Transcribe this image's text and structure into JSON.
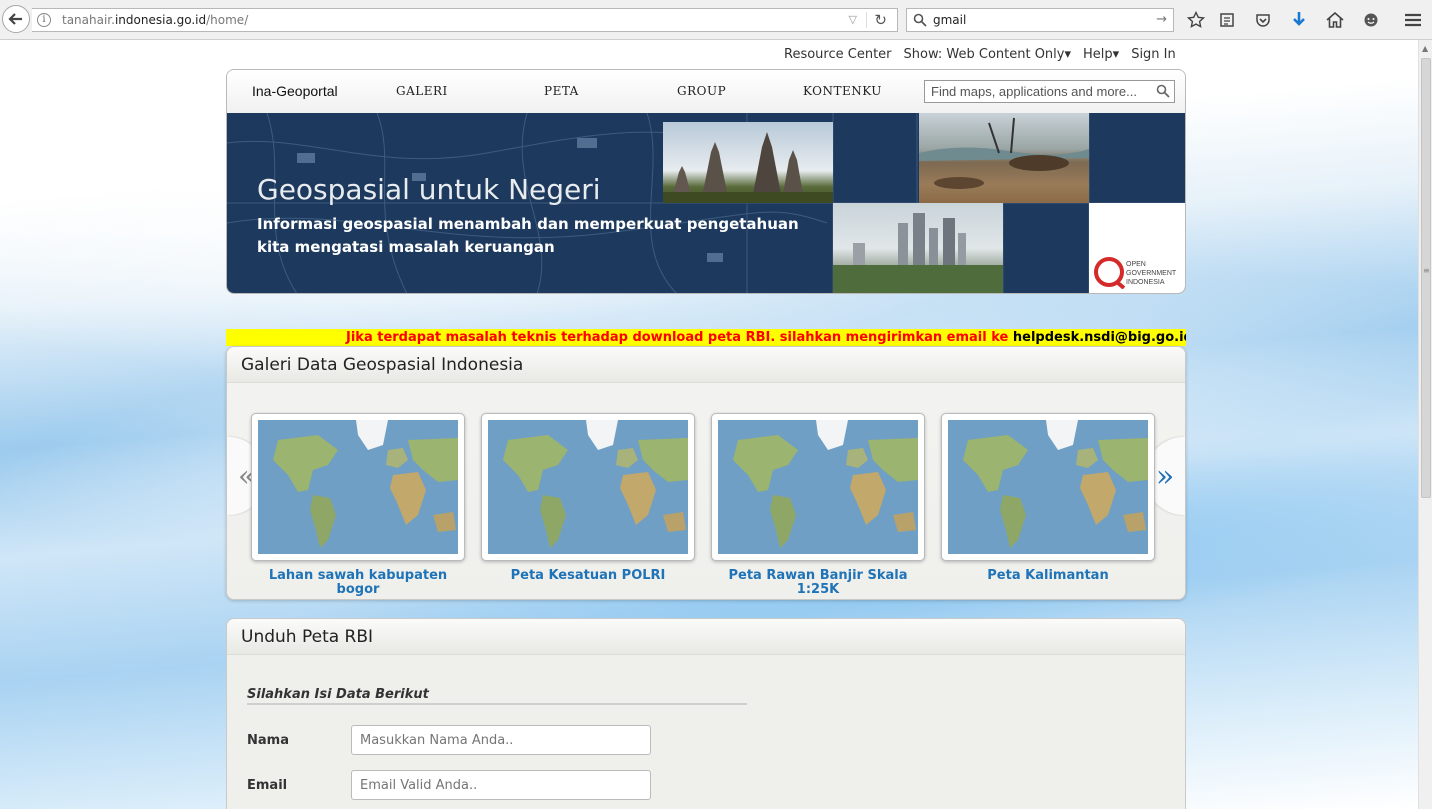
{
  "browser": {
    "url_prefix": "tanahair.",
    "url_host": "indonesia.go.id",
    "url_path": "/home/",
    "search_value": "gmail"
  },
  "top_links": [
    "Resource Center",
    "Show: Web Content Only▾",
    "Help▾",
    "Sign In"
  ],
  "nav": {
    "brand": "Ina-Geoportal",
    "items": [
      "GALERI",
      "PETA",
      "GROUP",
      "KONTENKU"
    ],
    "search_placeholder": "Find maps, applications and more..."
  },
  "banner": {
    "title": "Geospasial untuk Negeri",
    "subtitle": "Informasi geospasial menambah dan memperkuat pengetahuan kita mengatasi masalah keruangan",
    "logo_lines": [
      "OPEN",
      "GOVERNMENT",
      "INDONESIA"
    ]
  },
  "notice": {
    "text": "Jika terdapat masalah teknis terhadap download peta RBI. silahkan mengirimkan email ke ",
    "email": "helpdesk.nsdi@big.go.id",
    "color": "#ff0000",
    "background": "#ffff00"
  },
  "gallery": {
    "title": "Galeri Data Geospasial Indonesia",
    "items": [
      {
        "caption": "Lahan sawah kabupaten bogor"
      },
      {
        "caption": "Peta Kesatuan POLRI"
      },
      {
        "caption": "Peta Rawan Banjir Skala 1:25K"
      },
      {
        "caption": "Peta Kalimantan"
      }
    ],
    "prev_label": "«",
    "next_label": "»"
  },
  "download": {
    "title": "Unduh Peta RBI",
    "section_title": "Silahkan Isi Data Berikut",
    "fields": [
      {
        "label": "Nama",
        "placeholder": "Masukkan Nama Anda.."
      },
      {
        "label": "Email",
        "placeholder": "Email Valid Anda.."
      }
    ]
  },
  "colors": {
    "link_blue": "#1f73b7",
    "banner_navy": "#1d3a5e"
  }
}
